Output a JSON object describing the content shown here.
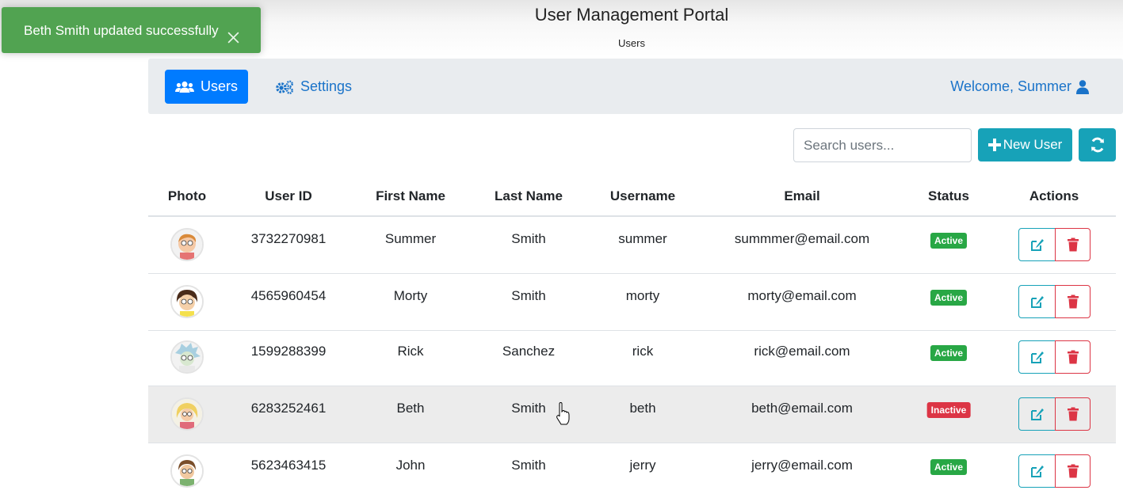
{
  "toast": {
    "message": "Beth Smith updated successfully"
  },
  "header": {
    "title": "User Management Portal",
    "breadcrumb": "Users"
  },
  "nav": {
    "users_label": "Users",
    "settings_label": "Settings",
    "welcome": "Welcome, Summer"
  },
  "toolbar": {
    "search_placeholder": "Search users...",
    "new_user_label": "New User"
  },
  "table": {
    "columns": [
      "Photo",
      "User ID",
      "First Name",
      "Last Name",
      "Username",
      "Email",
      "Status",
      "Actions"
    ],
    "rows": [
      {
        "user_id": "3732270981",
        "first": "Summer",
        "last": "Smith",
        "username": "summer",
        "email": "summmer@email.com",
        "status": "Active"
      },
      {
        "user_id": "4565960454",
        "first": "Morty",
        "last": "Smith",
        "username": "morty",
        "email": "morty@email.com",
        "status": "Active"
      },
      {
        "user_id": "1599288399",
        "first": "Rick",
        "last": "Sanchez",
        "username": "rick",
        "email": "rick@email.com",
        "status": "Active"
      },
      {
        "user_id": "6283252461",
        "first": "Beth",
        "last": "Smith",
        "username": "beth",
        "email": "beth@email.com",
        "status": "Inactive"
      },
      {
        "user_id": "5623463415",
        "first": "John",
        "last": "Smith",
        "username": "jerry",
        "email": "jerry@email.com",
        "status": "Active"
      }
    ]
  },
  "colors": {
    "primary": "#007bff",
    "info": "#17a2b8",
    "success": "#28a745",
    "danger": "#dc3545",
    "toast": "#51a351"
  }
}
